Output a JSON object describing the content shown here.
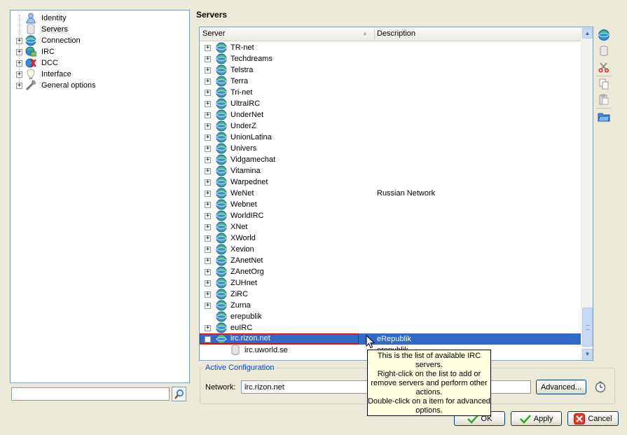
{
  "left_tree": {
    "items": [
      {
        "label": "Identity",
        "icon": "person-icon",
        "expandable": false
      },
      {
        "label": "Servers",
        "icon": "server-icon",
        "expandable": false,
        "selected": true
      },
      {
        "label": "Connection",
        "icon": "globe-icon",
        "expandable": true
      },
      {
        "label": "IRC",
        "icon": "irc-icon",
        "expandable": true
      },
      {
        "label": "DCC",
        "icon": "dcc-icon",
        "expandable": true
      },
      {
        "label": "Interface",
        "icon": "lightbulb-icon",
        "expandable": true
      },
      {
        "label": "General options",
        "icon": "wrench-icon",
        "expandable": true
      }
    ],
    "search_value": ""
  },
  "panel_title": "Servers",
  "server_list": {
    "columns": {
      "server": "Server",
      "description": "Description"
    },
    "rows": [
      {
        "name": "TR-net",
        "description": ""
      },
      {
        "name": "Techdreams",
        "description": ""
      },
      {
        "name": "Telstra",
        "description": ""
      },
      {
        "name": "Terra",
        "description": ""
      },
      {
        "name": "Tri-net",
        "description": ""
      },
      {
        "name": "UltraIRC",
        "description": ""
      },
      {
        "name": "UnderNet",
        "description": ""
      },
      {
        "name": "UnderZ",
        "description": ""
      },
      {
        "name": "UnionLatina",
        "description": ""
      },
      {
        "name": "Univers",
        "description": ""
      },
      {
        "name": "Vidgamechat",
        "description": ""
      },
      {
        "name": "Vitamina",
        "description": ""
      },
      {
        "name": "Warpednet",
        "description": ""
      },
      {
        "name": "WeNet",
        "description": "Russian Network"
      },
      {
        "name": "Webnet",
        "description": ""
      },
      {
        "name": "WorldIRC",
        "description": ""
      },
      {
        "name": "XNet",
        "description": ""
      },
      {
        "name": "XWorld",
        "description": ""
      },
      {
        "name": "Xevion",
        "description": ""
      },
      {
        "name": "ZAnetNet",
        "description": ""
      },
      {
        "name": "ZAnetOrg",
        "description": ""
      },
      {
        "name": "ZUHnet",
        "description": ""
      },
      {
        "name": "ZiRC",
        "description": ""
      },
      {
        "name": "Zurna",
        "description": ""
      },
      {
        "name": "erepublik",
        "description": "",
        "no_expander": true
      },
      {
        "name": "euIRC",
        "description": ""
      },
      {
        "name": "irc.rizon.net",
        "description": "eRepublik",
        "selected": true,
        "expanded": true
      },
      {
        "name": "irc.uworld.se",
        "description": "erepublik",
        "child": true
      }
    ]
  },
  "toolbar": {
    "buttons": [
      "new-network-icon",
      "new-server-icon",
      "cut-icon",
      "copy-icon",
      "paste-icon",
      "import-folder-icon"
    ]
  },
  "active_config": {
    "legend": "Active Configuration",
    "network_label": "Network:",
    "network_value": "irc.rizon.net",
    "advanced_label": "Advanced..."
  },
  "buttons": {
    "ok": "OK",
    "apply": "Apply",
    "cancel": "Cancel"
  },
  "tooltip": {
    "lines": [
      "This is the list of available IRC",
      "servers.",
      "Right-click on the list to add or",
      "remove servers and perform other",
      "actions.",
      "Double-click on a item for advanced",
      "options."
    ]
  },
  "colors": {
    "selection": "#316ac5",
    "tooltip_bg": "#ffffe1",
    "window_bg": "#ece9d8"
  }
}
